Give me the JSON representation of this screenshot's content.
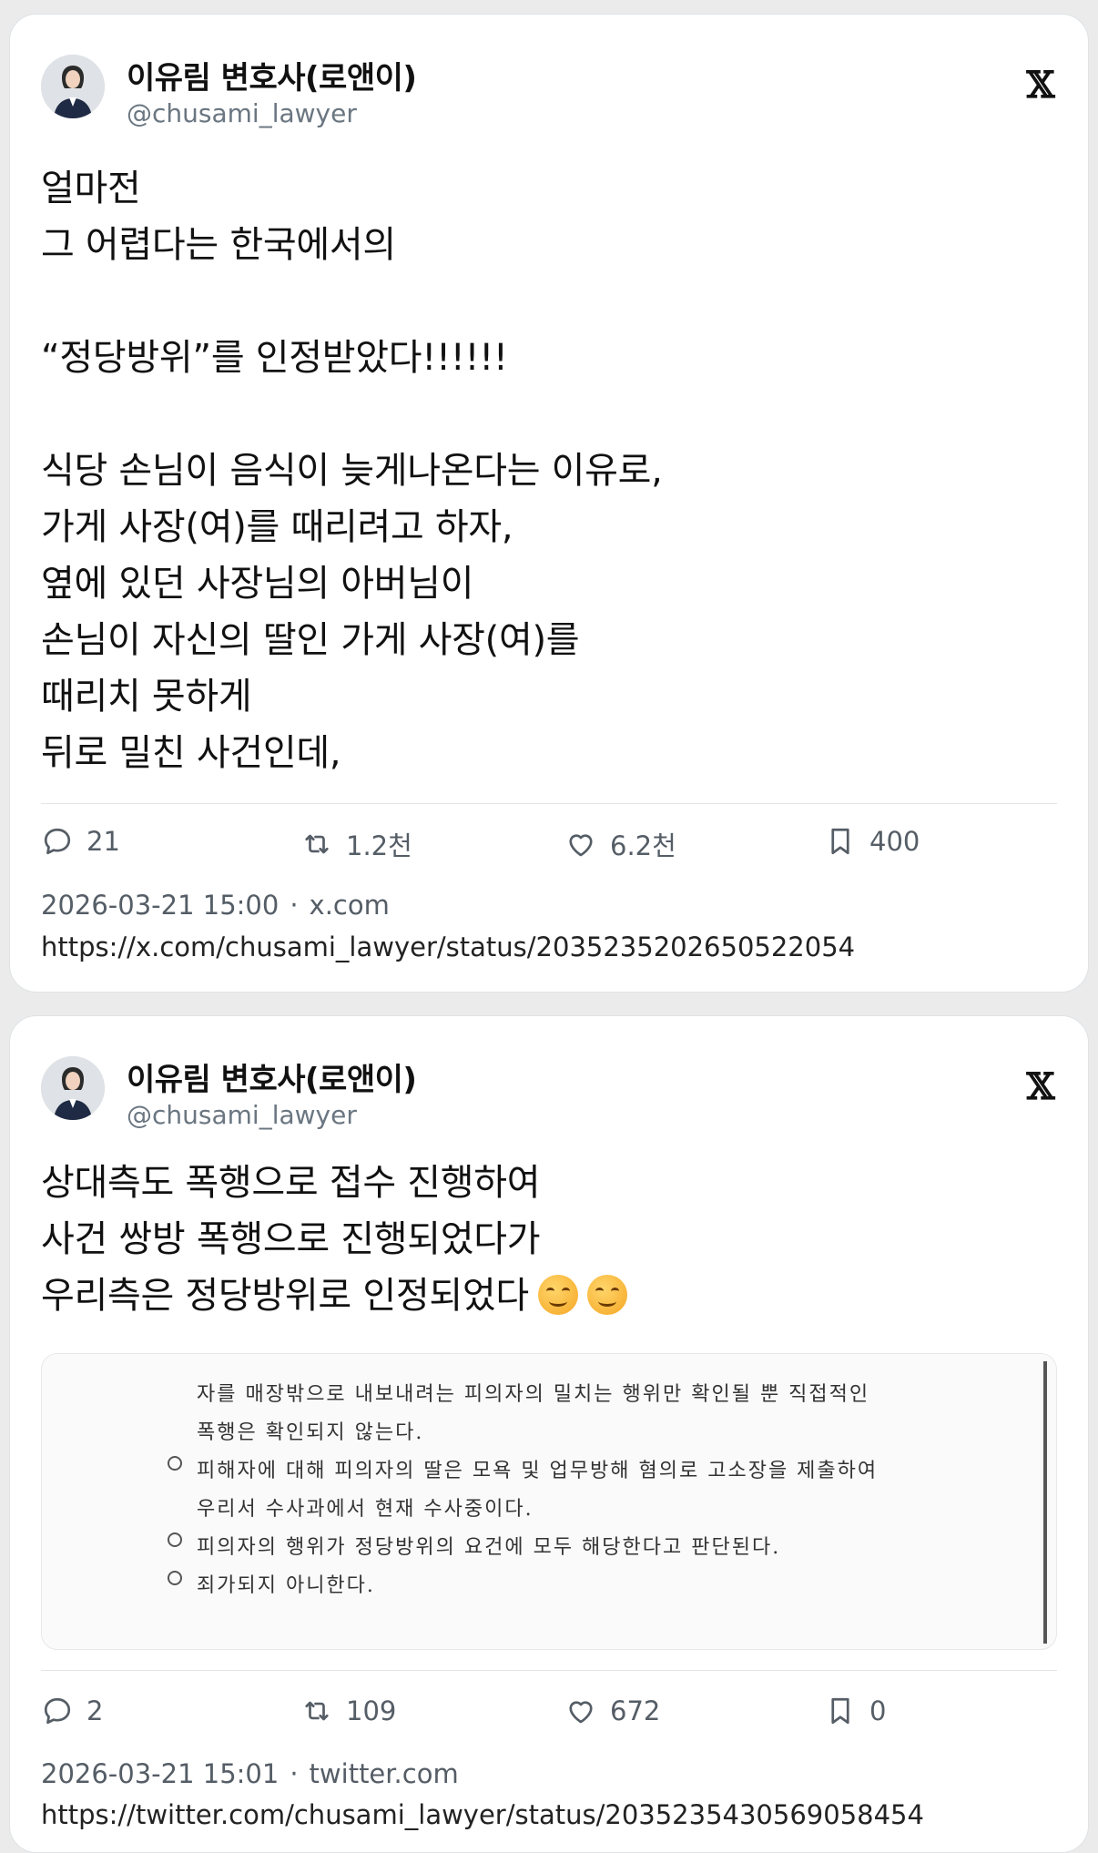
{
  "posts": [
    {
      "author_name": "이유림 변호사(로앤이)",
      "handle": "@chusami_lawyer",
      "platform_icon": "x-logo-icon",
      "text": "얼마전\n그 어렵다는 한국에서의\n\n“정당방위”를 인정받았다!!!!!!\n\n식당 손님이 음식이 늦게나온다는 이유로,\n가게 사장(여)를 때리려고 하자,\n옆에 있던 사장님의 아버님이\n손님이 자신의 딸인 가게 사장(여)를\n때리치 못하게\n뒤로 밀친 사건인데,",
      "replies": "21",
      "reposts": "1.2천",
      "likes": "6.2천",
      "bookmarks": "400",
      "timestamp": "2026-03-21 15:00",
      "source": "x.com",
      "url": "https://x.com/chusami_lawyer/status/2035235202650522054"
    },
    {
      "author_name": "이유림 변호사(로앤이)",
      "handle": "@chusami_lawyer",
      "platform_icon": "x-logo-icon",
      "text": "상대측도 폭행으로 접수 진행하여\n사건 쌍방 폭행으로 진행되었다가\n우리측은 정당방위로 인정되었다",
      "emoji": "smiling-face-emoji",
      "document_lines": [
        "자를 매장밖으로 내보내려는 피의자의 밀치는 행위만 확인될 뿐 직접적인",
        "폭행은 확인되지 않는다.",
        "피해자에 대해 피의자의 딸은 모욕 및 업무방해 혐의로 고소장을 제출하여",
        "우리서 수사과에서 현재 수사중이다.",
        "피의자의 행위가 정당방위의 요건에 모두 해당한다고 판단된다.",
        "죄가되지 아니한다."
      ],
      "replies": "2",
      "reposts": "109",
      "likes": "672",
      "bookmarks": "0",
      "timestamp": "2026-03-21 15:01",
      "source": "twitter.com",
      "url": "https://twitter.com/chusami_lawyer/status/2035235430569058454"
    }
  ],
  "meta_separator": "·"
}
